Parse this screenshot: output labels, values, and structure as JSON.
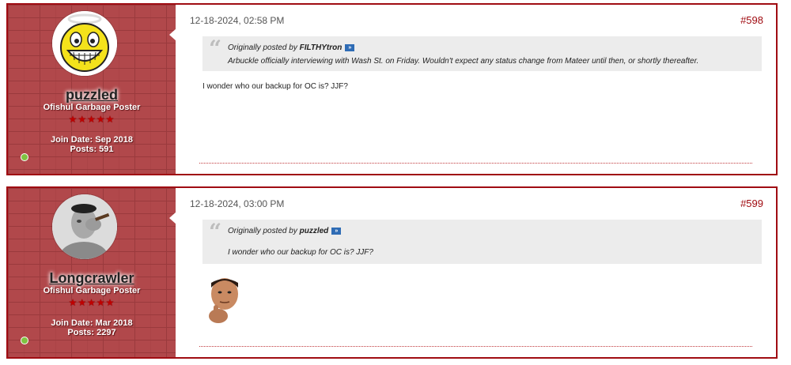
{
  "posts": [
    {
      "author": {
        "username": "puzzled",
        "title": "Ofishul Garbage Poster",
        "stars": "★★★★★",
        "join_date": "Join Date: Sep 2018",
        "posts_count": "Posts: 591",
        "avatar": "smiley-halo-icon"
      },
      "date": "12-18-2024, 02:58 PM",
      "post_number": "#598",
      "quote": {
        "prefix": "Originally posted by ",
        "quoted_user": "FILTHYtron",
        "text": "Arbuckle officially interviewing with Wash St. on Friday. Wouldn't expect any status change from Mateer until then, or shortly thereafter."
      },
      "body": "I wonder who our backup for OC is? JJF?"
    },
    {
      "author": {
        "username": "Longcrawler",
        "title": "Ofishul Garbage Poster",
        "stars": "★★★★★",
        "join_date": "Join Date: Mar 2018",
        "posts_count": "Posts: 2297",
        "avatar": "popeye-avatar-icon"
      },
      "date": "12-18-2024, 03:00 PM",
      "post_number": "#599",
      "quote": {
        "prefix": "Originally posted by ",
        "quoted_user": "puzzled",
        "text": "I wonder who our backup for OC is? JJF?"
      },
      "body_image": "thinking-man-image"
    }
  ],
  "colors": {
    "accent": "#a00c12",
    "user_panel": "#b1484b",
    "quote_bg": "#ececec",
    "online": "#7fc241"
  }
}
